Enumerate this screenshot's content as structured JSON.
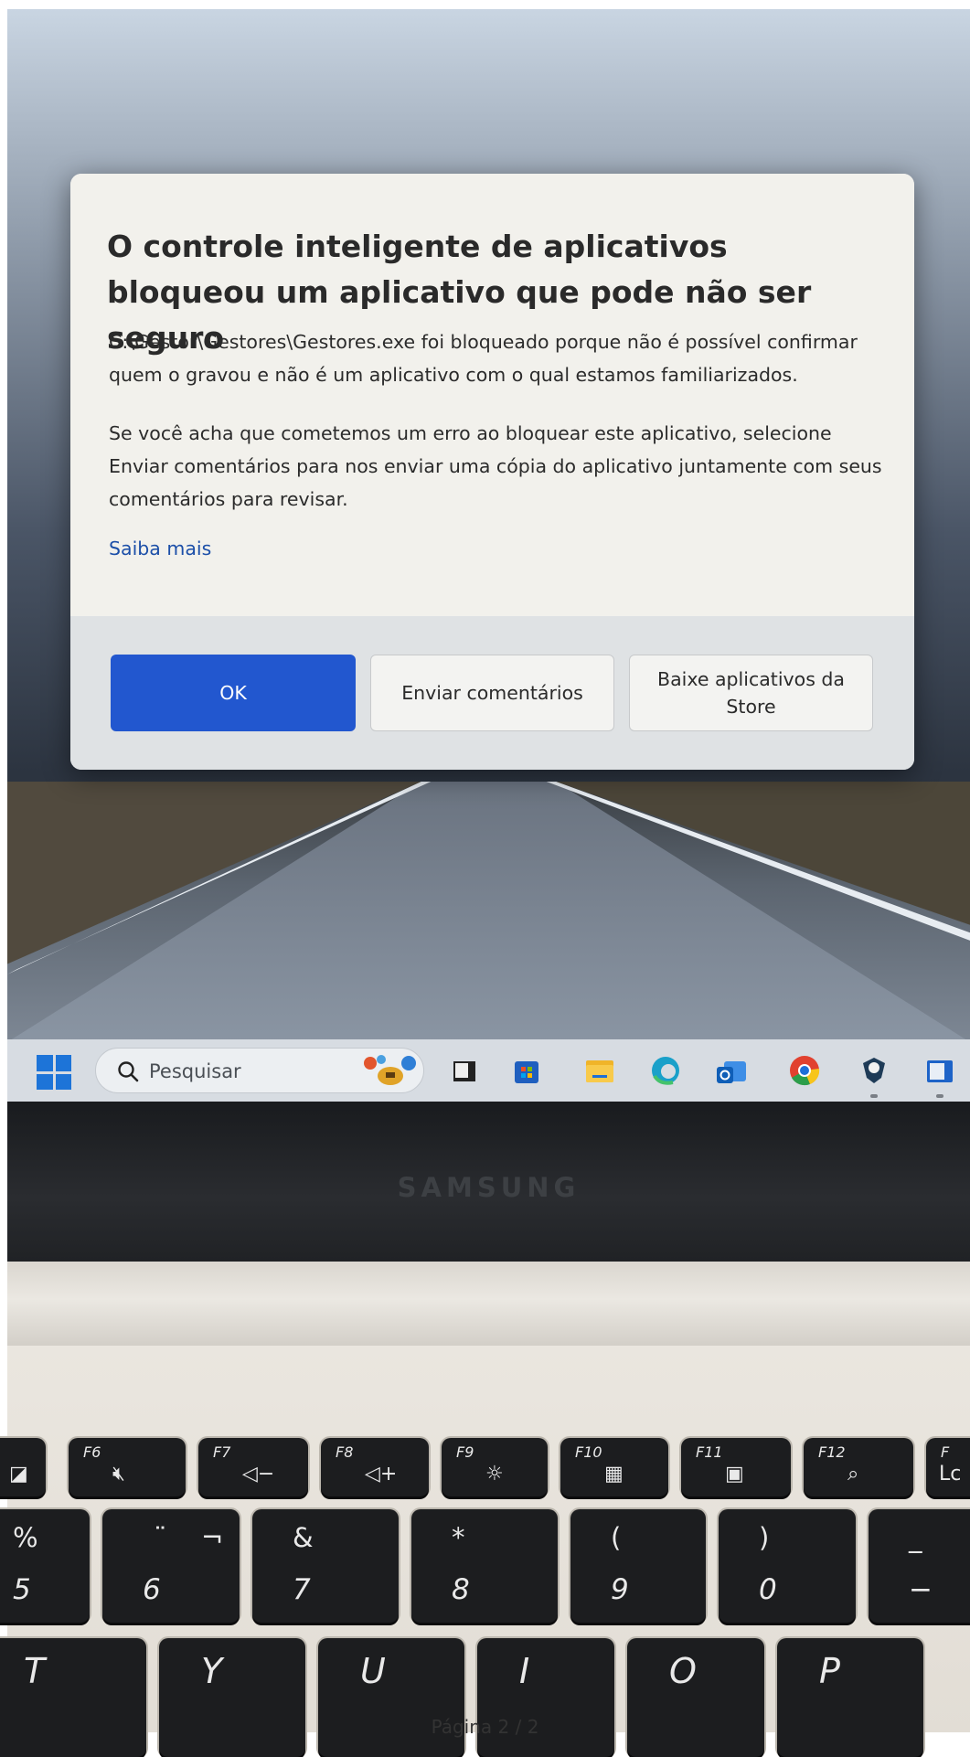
{
  "dialog": {
    "title": "O controle inteligente de aplicativos bloqueou um aplicativo que pode não ser seguro",
    "paragraph1": "C:\\Gestor\\Gestores\\Gestores.exe foi bloqueado porque não é possível confirmar quem o gravou e não é um aplicativo com o qual estamos familiarizados.",
    "paragraph2": "Se você acha que cometemos um erro ao bloquear este aplicativo, selecione Enviar comentários para nos enviar uma cópia do aplicativo juntamente com seus comentários para revisar.",
    "learn_more": "Saiba mais",
    "buttons": {
      "ok": "OK",
      "feedback": "Enviar comentários",
      "store": "Baixe aplicativos da Store"
    }
  },
  "taskbar": {
    "search_placeholder": "Pesquisar",
    "icons": [
      "start-icon",
      "search-icon",
      "task-view-icon",
      "microsoft-store-icon",
      "file-explorer-icon",
      "edge-icon",
      "outlook-icon",
      "chrome-icon",
      "app-icon",
      "window-icon"
    ]
  },
  "laptop": {
    "brand": "SAMSUNG"
  },
  "keyboard": {
    "function_keys": [
      {
        "name": "F6",
        "icon": "mute-icon",
        "glyph": "🔇"
      },
      {
        "name": "F7",
        "icon": "volume-down-icon",
        "glyph": "◁−"
      },
      {
        "name": "F8",
        "icon": "volume-up-icon",
        "glyph": "◁+"
      },
      {
        "name": "F9",
        "icon": "brightness-icon",
        "glyph": "☼"
      },
      {
        "name": "F10",
        "icon": "keyboard-backlight-icon",
        "glyph": "▦"
      },
      {
        "name": "F11",
        "icon": "privacy-camera-icon",
        "glyph": "▣"
      },
      {
        "name": "F12",
        "icon": "screen-lock-icon",
        "glyph": "⌕"
      },
      {
        "name": "F",
        "icon": "",
        "glyph": "Lc"
      }
    ],
    "number_keys": [
      {
        "top": "%",
        "bottom": "5"
      },
      {
        "top_left": "¢",
        "top": "¨",
        "top_right": "¬",
        "bottom": "6"
      },
      {
        "top": "&",
        "bottom": "7"
      },
      {
        "top": "*",
        "bottom": "8"
      },
      {
        "top": "(",
        "bottom": "9"
      },
      {
        "top": ")",
        "bottom": "0"
      },
      {
        "top": "_",
        "bottom": "−"
      }
    ],
    "letter_keys": [
      "T",
      "Y",
      "U",
      "I",
      "O",
      "P"
    ]
  },
  "page_footer": "Página 2 / 2"
}
